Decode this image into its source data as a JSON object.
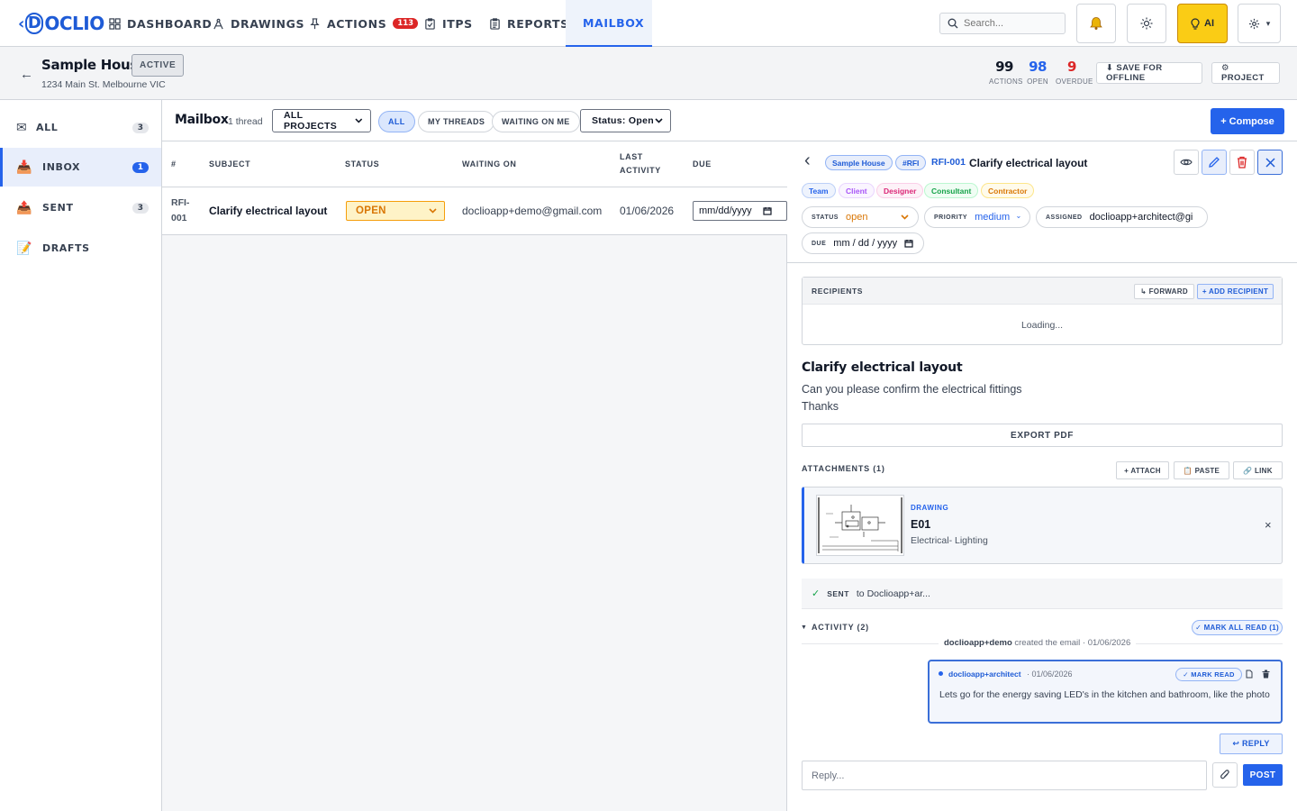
{
  "nav": {
    "logo": "DOCLIO",
    "items": [
      {
        "label": "DASHBOARD"
      },
      {
        "label": "DRAWINGS"
      },
      {
        "label": "ACTIONS",
        "badge": "113"
      },
      {
        "label": "ITPS"
      },
      {
        "label": "REPORTS"
      },
      {
        "label": "MAILBOX"
      }
    ],
    "search_placeholder": "Search...",
    "ai_label": "AI",
    "settings_caret": "▾"
  },
  "project": {
    "back": "←",
    "name": "Sample House",
    "status": "ACTIVE",
    "address": "1234 Main St. Melbourne VIC",
    "stats": [
      {
        "value": "99",
        "label": "ACTIONS",
        "color": "#111827"
      },
      {
        "value": "98",
        "label": "OPEN",
        "color": "#2563eb"
      },
      {
        "value": "9",
        "label": "OVERDUE",
        "color": "#dc2626"
      }
    ],
    "save_offline": "⬇ SAVE FOR OFFLINE",
    "project_btn": "⚙ PROJECT"
  },
  "sidebar": {
    "items": [
      {
        "icon": "✉",
        "label": "ALL",
        "count": "3"
      },
      {
        "icon": "📥",
        "label": "INBOX",
        "count": "1"
      },
      {
        "icon": "📤",
        "label": "SENT",
        "count": "3"
      },
      {
        "icon": "📝",
        "label": "DRAFTS"
      }
    ]
  },
  "mailbar": {
    "title": "Mailbox",
    "thread_count": "1 thread",
    "project_filter": "ALL PROJECTS",
    "pills": [
      "ALL",
      "MY THREADS",
      "WAITING ON ME"
    ],
    "status_filter": "Status: Open",
    "compose": "+ Compose"
  },
  "table": {
    "headers": [
      "#",
      "SUBJECT",
      "STATUS",
      "WAITING ON",
      "LAST ACTIVITY",
      "DUE"
    ],
    "rows": [
      {
        "id_line1": "RFI-",
        "id_line2": "001",
        "subject": "Clarify electrical layout",
        "status": "OPEN",
        "waiting_on": "doclioapp+demo@gmail.com",
        "last_activity": "01/06/2026",
        "due": "mm/dd/yyyy"
      }
    ]
  },
  "detail": {
    "back": "‹",
    "project_chip": "Sample House",
    "type_chip": "#RFI",
    "ref": "RFI-001",
    "title": "Clarify electrical layout",
    "audience_chips": [
      {
        "label": "Team",
        "color": "#2563eb",
        "bg": "#eef3fd",
        "border": "#bcd0f7"
      },
      {
        "label": "Client",
        "color": "#a855f7",
        "bg": "#faf5ff",
        "border": "#e9d5ff"
      },
      {
        "label": "Designer",
        "color": "#db2777",
        "bg": "#fdf2f8",
        "border": "#fbcfe8"
      },
      {
        "label": "Consultant",
        "color": "#16a34a",
        "bg": "#f0fdf4",
        "border": "#bbf7d0"
      },
      {
        "label": "Contractor",
        "color": "#d97706",
        "bg": "#fffbeb",
        "border": "#fde68a"
      }
    ],
    "status_label": "STATUS",
    "status_value": "open",
    "priority_label": "PRIORITY",
    "priority_value": "medium",
    "assigned_label": "ASSIGNED",
    "assigned_value": "doclioapp+architect@gi",
    "due_label": "DUE",
    "due_value": "mm / dd / yyyy",
    "recipients_label": "RECIPIENTS",
    "forward": "↳ FORWARD",
    "add_recipient": "+ ADD RECIPIENT",
    "loading": "Loading...",
    "body_title": "Clarify electrical layout",
    "body_line1": "Can you please confirm the electrical fittings",
    "body_line2": "Thanks",
    "export_pdf": "EXPORT PDF",
    "attachments_label": "ATTACHMENTS (1)",
    "attach": "+ ATTACH",
    "paste": "📋 PASTE",
    "link": "🔗 LINK",
    "attachment": {
      "kind": "DRAWING",
      "name": "E01",
      "desc": "Electrical- Lighting",
      "remove": "×"
    },
    "sent_label": "SENT",
    "sent_to": "to Doclioapp+ar...",
    "activity_label": "ACTIVITY (2)",
    "mark_all_read": "✓ MARK ALL READ (1)",
    "created_user": "doclioapp+demo",
    "created_text": "created the email · 01/06/2026",
    "comment": {
      "author": "doclioapp+architect",
      "date": "· 01/06/2026",
      "mark_read": "✓ MARK READ",
      "text": "Lets go for the energy saving LED's in the kitchen and bathroom, like the photo"
    },
    "reply": "↩ REPLY",
    "reply_placeholder": "Reply...",
    "post": "POST"
  }
}
